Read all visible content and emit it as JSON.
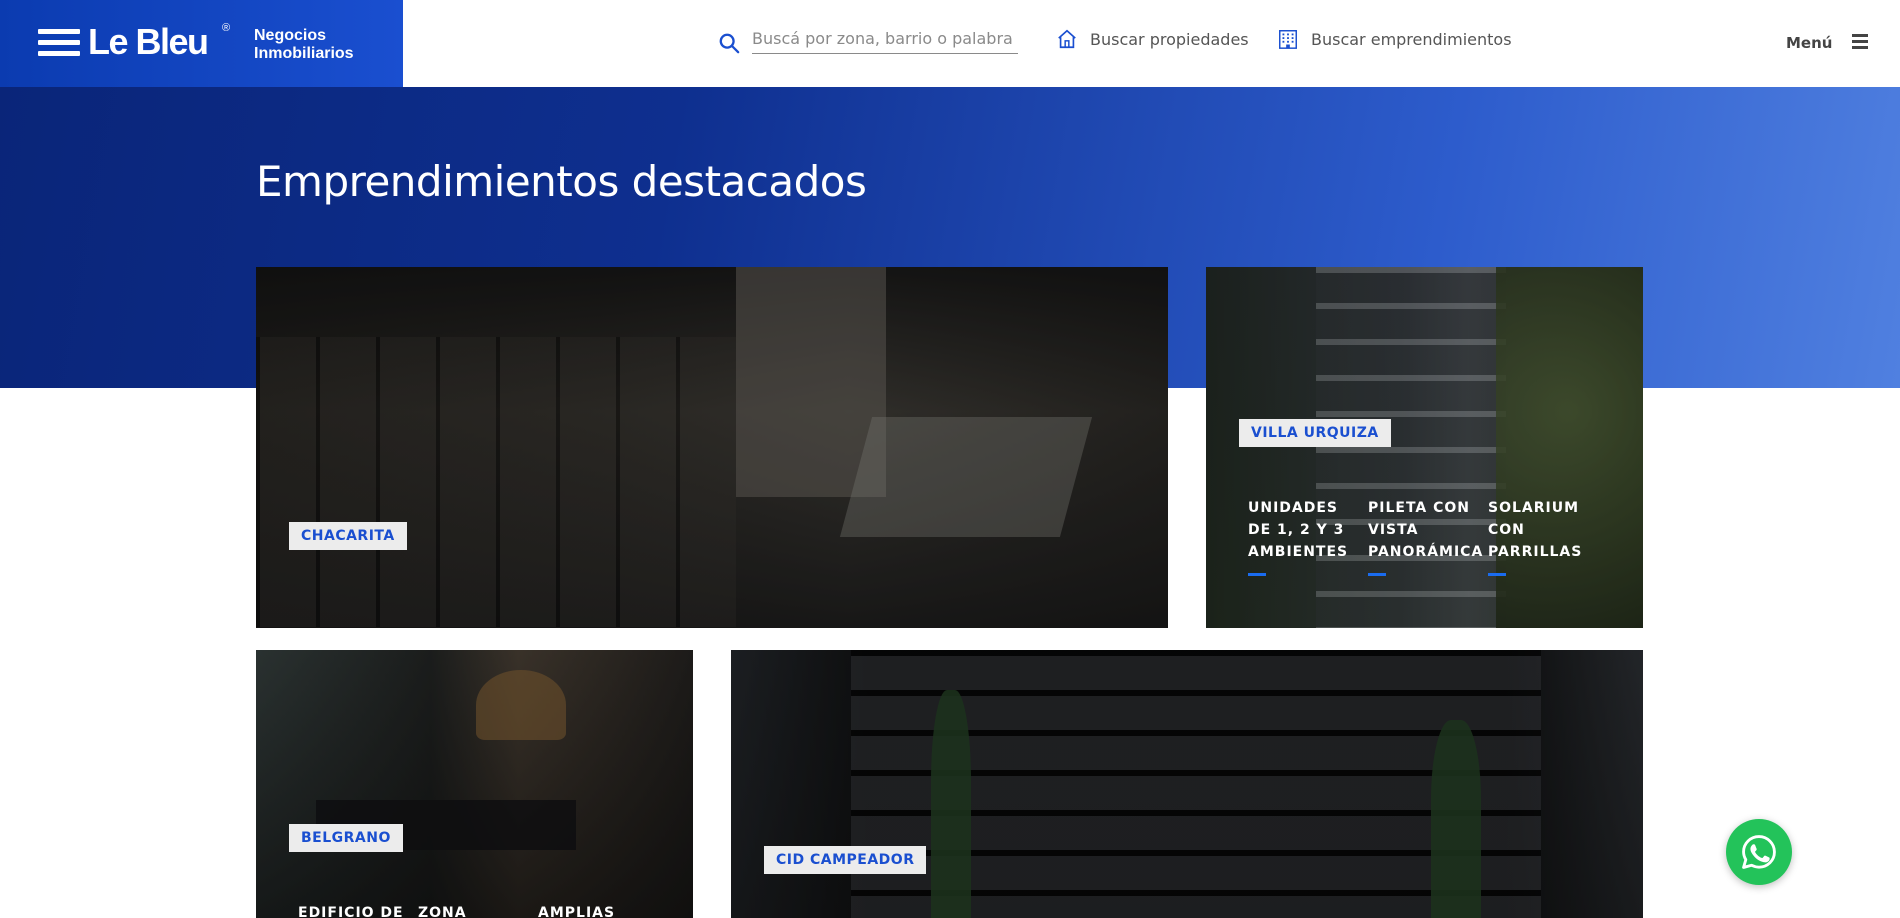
{
  "brand": {
    "name": "Le Bleu",
    "registered": "®",
    "tagline_line1": "Negocios",
    "tagline_line2": "Inmobiliarios",
    "color": "#1a4fd0"
  },
  "header": {
    "search": {
      "placeholder": "Buscá por zona, barrio o palabra clave",
      "value": ""
    },
    "nav": [
      {
        "label": "Buscar propiedades",
        "icon": "house-icon"
      },
      {
        "label": "Buscar emprendimientos",
        "icon": "building-icon"
      }
    ],
    "menu_label": "Menú"
  },
  "hero": {
    "title": "Emprendimientos destacados"
  },
  "projects": [
    {
      "location": "CHACARITA",
      "features": []
    },
    {
      "location": "VILLA URQUIZA",
      "features": [
        "UNIDADES DE 1, 2 Y 3 AMBIENTES",
        "PILETA CON VISTA PANORÁMICA",
        "SOLARIUM CON PARRILLAS"
      ]
    },
    {
      "location": "BELGRANO",
      "features": [
        "EDIFICIO DE",
        "ZONA",
        "AMPLIAS"
      ]
    },
    {
      "location": "CID CAMPEADOR",
      "features": []
    }
  ],
  "whatsapp": {
    "icon": "whatsapp-icon",
    "color": "#23c35a"
  }
}
